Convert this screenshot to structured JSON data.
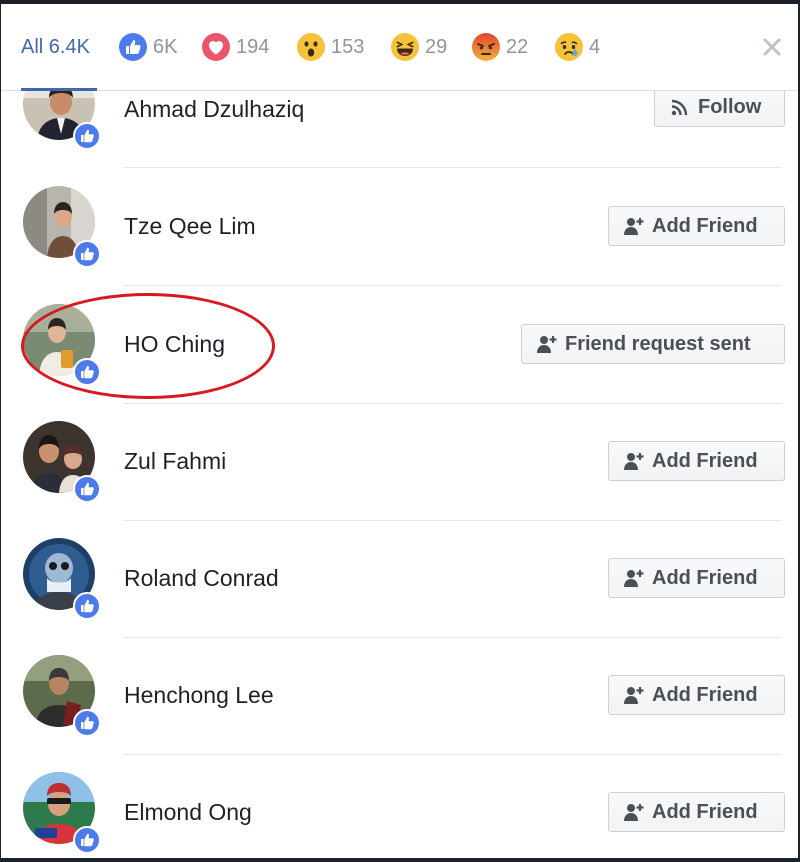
{
  "tabs": [
    {
      "label": "All 6.4K",
      "count": "",
      "icon": "all"
    },
    {
      "label": "",
      "count": "6K",
      "icon": "like-icon"
    },
    {
      "label": "",
      "count": "194",
      "icon": "love-icon"
    },
    {
      "label": "",
      "count": "153",
      "icon": "wow-icon"
    },
    {
      "label": "",
      "count": "29",
      "icon": "haha-icon"
    },
    {
      "label": "",
      "count": "22",
      "icon": "angry-icon"
    },
    {
      "label": "",
      "count": "4",
      "icon": "sad-icon"
    }
  ],
  "colors": {
    "accent": "#4267b2",
    "like_badge": "#4e7bea",
    "love": "#e9566b",
    "emoji_yellow": "#f5c33b",
    "angry": "#e8703a",
    "highlight": "#d71921"
  },
  "people": [
    {
      "name": "Ahmad Dzulhaziq",
      "button": "Follow",
      "button_icon": "rss-icon",
      "reaction": "like-badge-icon"
    },
    {
      "name": "Tze Qee Lim",
      "button": "Add Friend",
      "button_icon": "add-friend-icon",
      "reaction": "like-badge-icon"
    },
    {
      "name": "HO Ching",
      "button": "Friend request sent",
      "button_icon": "add-friend-icon",
      "reaction": "like-badge-icon"
    },
    {
      "name": "Zul Fahmi",
      "button": "Add Friend",
      "button_icon": "add-friend-icon",
      "reaction": "like-badge-icon"
    },
    {
      "name": "Roland Conrad",
      "button": "Add Friend",
      "button_icon": "add-friend-icon",
      "reaction": "like-badge-icon"
    },
    {
      "name": "Henchong Lee",
      "button": "Add Friend",
      "button_icon": "add-friend-icon",
      "reaction": "like-badge-icon"
    },
    {
      "name": "Elmond Ong",
      "button": "Add Friend",
      "button_icon": "add-friend-icon",
      "reaction": "like-badge-icon"
    }
  ]
}
